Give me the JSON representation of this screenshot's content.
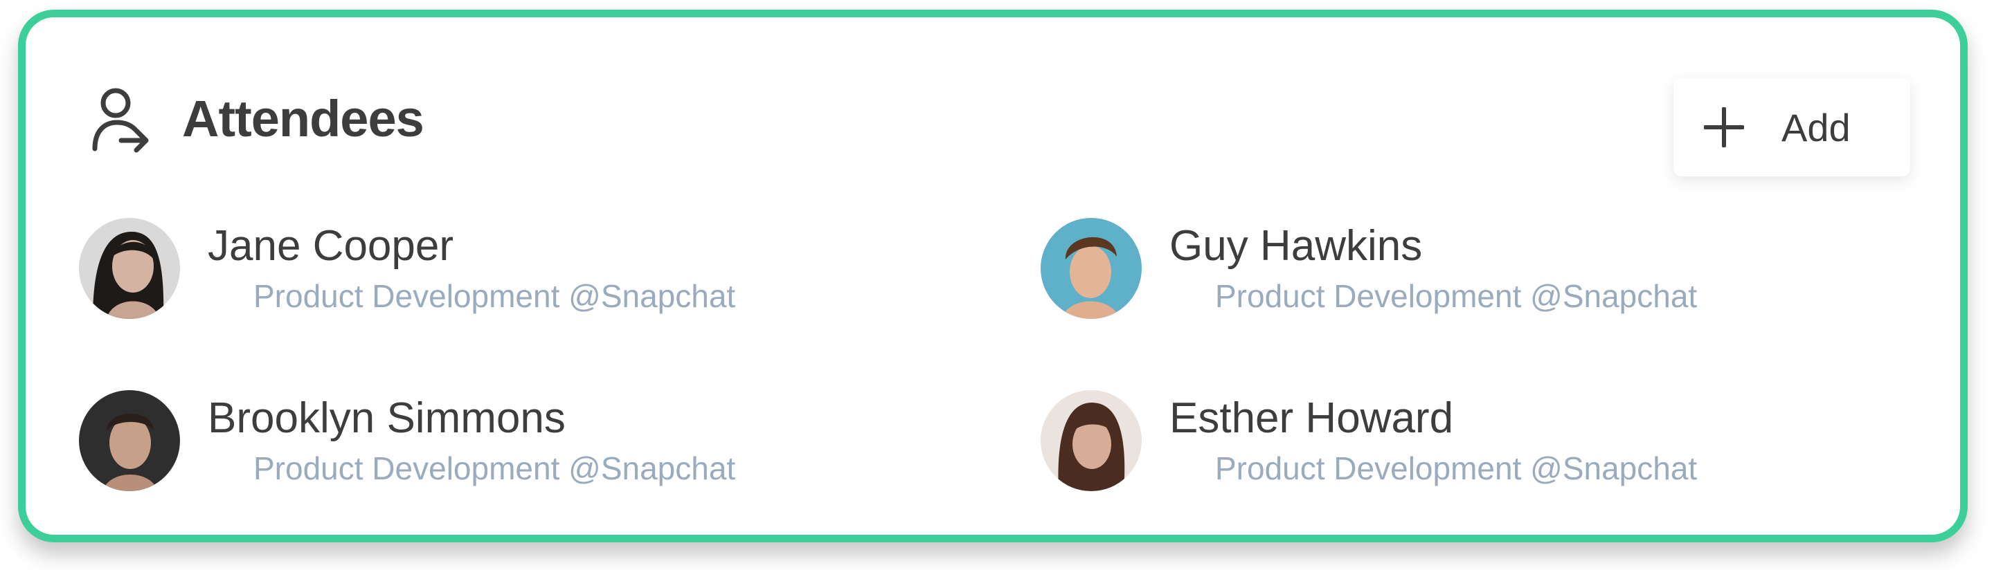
{
  "header": {
    "icon": "user-add-icon",
    "title": "Attendees",
    "add_button": {
      "icon": "plus-icon",
      "label": "Add"
    }
  },
  "attendees": [
    {
      "name": "Jane Cooper",
      "role": "Product Development @Snapchat",
      "avatar": "avatar-photo"
    },
    {
      "name": "Guy Hawkins",
      "role": "Product Development @Snapchat",
      "avatar": "avatar-photo"
    },
    {
      "name": "Brooklyn Simmons",
      "role": "Product Development @Snapchat",
      "avatar": "avatar-photo"
    },
    {
      "name": "Esther Howard",
      "role": "Product Development @Snapchat",
      "avatar": "avatar-photo"
    }
  ],
  "colors": {
    "border": "#3ccf9a",
    "text": "#3d3d3d",
    "muted": "#9aabbd"
  }
}
